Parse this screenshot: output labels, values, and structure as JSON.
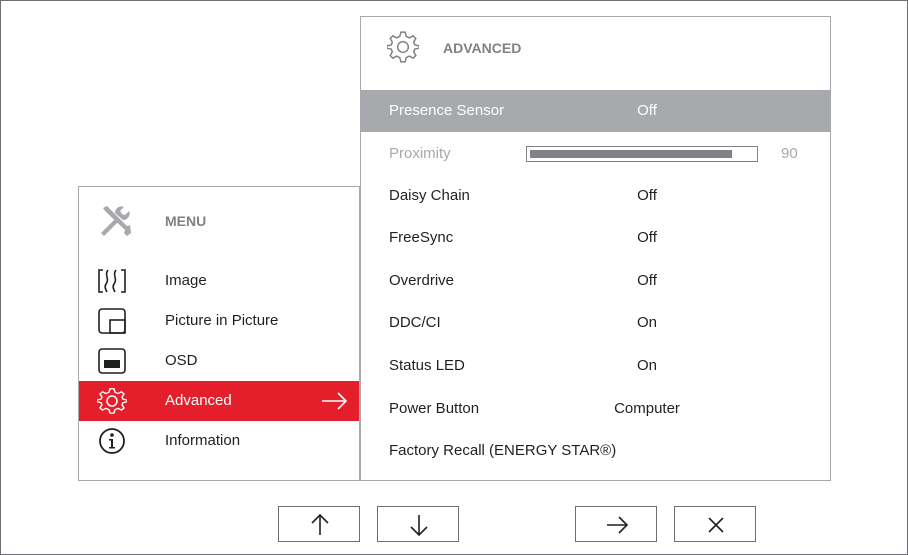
{
  "menu": {
    "title": "MENU",
    "items": [
      {
        "label": "Image",
        "icon": "image-icon"
      },
      {
        "label": "Picture in Picture",
        "icon": "picture-in-picture-icon"
      },
      {
        "label": "OSD",
        "icon": "osd-icon"
      },
      {
        "label": "Advanced",
        "icon": "gear-icon",
        "active": true
      },
      {
        "label": "Information",
        "icon": "info-icon"
      }
    ]
  },
  "advanced": {
    "title": "ADVANCED",
    "rows": [
      {
        "label": "Presence Sensor",
        "value": "Off",
        "state": "selected"
      },
      {
        "label": "Proximity",
        "value": "90",
        "state": "disabled",
        "level_percent": 90
      },
      {
        "label": "Daisy Chain",
        "value": "Off"
      },
      {
        "label": "FreeSync",
        "value": "Off"
      },
      {
        "label": "Overdrive",
        "value": "Off"
      },
      {
        "label": "DDC/CI",
        "value": "On"
      },
      {
        "label": "Status LED",
        "value": "On"
      },
      {
        "label": "Power Button",
        "value": "Computer"
      },
      {
        "label": "Factory Recall (ENERGY STAR®)",
        "value": ""
      }
    ]
  },
  "nav_buttons": [
    {
      "name": "up-arrow-icon"
    },
    {
      "name": "down-arrow-icon"
    },
    {
      "name": "right-arrow-icon"
    },
    {
      "name": "close-icon"
    }
  ],
  "colors": {
    "accent": "#e41f2b",
    "selected_row": "#a7a9ac",
    "border": "#6d6e71",
    "text": "#231f20"
  }
}
